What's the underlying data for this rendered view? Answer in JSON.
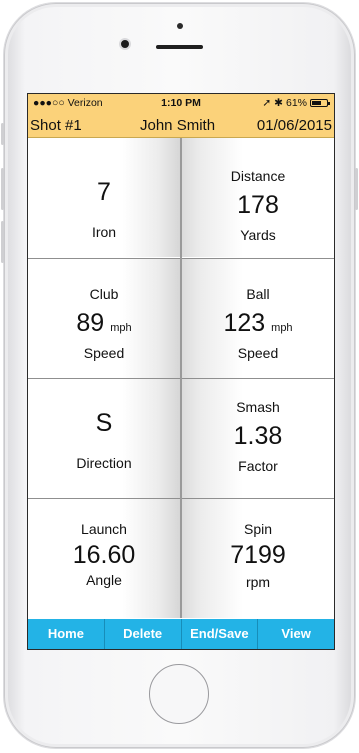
{
  "status_bar": {
    "carrier": "●●●○○ Verizon",
    "time": "1:10 PM",
    "battery": "61%",
    "battery_level": 0.61
  },
  "header": {
    "shot": "Shot #1",
    "player": "John Smith",
    "date": "01/06/2015"
  },
  "metrics": {
    "club": {
      "value": "7",
      "label": "Iron"
    },
    "distance": {
      "title": "Distance",
      "value": "178",
      "label": "Yards"
    },
    "club_speed": {
      "title": "Club",
      "value": "89",
      "unit": "mph",
      "label": "Speed"
    },
    "ball_speed": {
      "title": "Ball",
      "value": "123",
      "unit": "mph",
      "label": "Speed"
    },
    "direction": {
      "value": "S",
      "label": "Direction"
    },
    "smash": {
      "title": "Smash",
      "value": "1.38",
      "label": "Factor"
    },
    "launch": {
      "title": "Launch",
      "value": "16.60",
      "label": "Angle"
    },
    "spin": {
      "title": "Spin",
      "value": "7199",
      "label": "rpm"
    }
  },
  "toolbar": {
    "home": "Home",
    "delete": "Delete",
    "end_save": "End/Save",
    "view": "View"
  },
  "colors": {
    "header_bg": "#fbd27a",
    "toolbar_bg": "#23b3e6"
  }
}
